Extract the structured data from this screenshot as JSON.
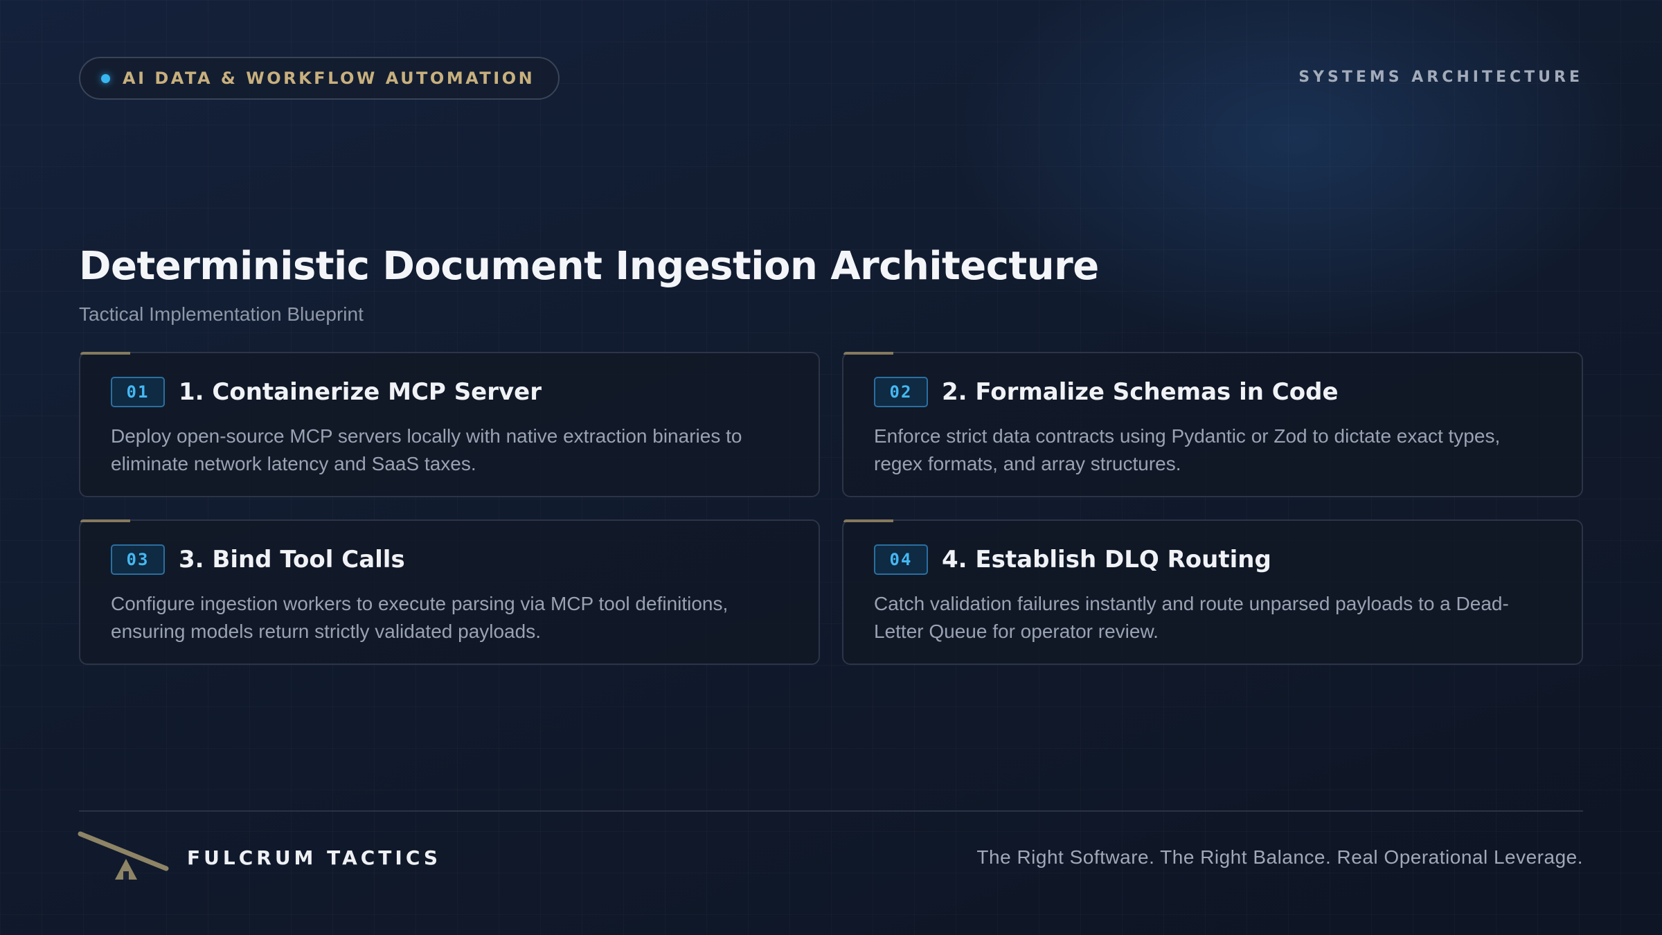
{
  "header": {
    "category_label": "AI DATA & WORKFLOW AUTOMATION",
    "section_label": "SYSTEMS ARCHITECTURE"
  },
  "main": {
    "title": "Deterministic Document Ingestion Architecture",
    "subtitle": "Tactical Implementation Blueprint",
    "cards": [
      {
        "number": "01",
        "title": "1. Containerize MCP Server",
        "body": "Deploy open-source MCP servers locally with native extraction binaries to eliminate network latency and SaaS taxes."
      },
      {
        "number": "02",
        "title": "2. Formalize Schemas in Code",
        "body": "Enforce strict data contracts using Pydantic or Zod to dictate exact types, regex formats, and array structures."
      },
      {
        "number": "03",
        "title": "3. Bind Tool Calls",
        "body": "Configure ingestion workers to execute parsing via MCP tool definitions, ensuring models return strictly validated payloads."
      },
      {
        "number": "04",
        "title": "4. Establish DLQ Routing",
        "body": "Catch validation failures instantly and route unparsed payloads to a Dead-Letter Queue for operator review."
      }
    ]
  },
  "footer": {
    "brand": "FULCRUM TACTICS",
    "tagline": "The Right Software. The Right Balance. Real Operational Leverage.",
    "logo_icon": "fulcrum-lever-icon"
  },
  "colors": {
    "background": "#111a2a",
    "accent_blue": "#38b6f0",
    "accent_gold": "#c8b07e",
    "card_border": "#2c3547"
  }
}
